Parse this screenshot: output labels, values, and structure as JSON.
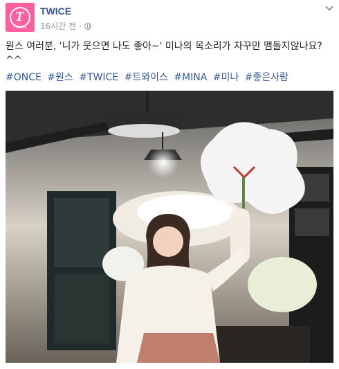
{
  "page": {
    "name": "TWICE",
    "avatar_label": "TWICE",
    "timestamp": "16시간 전"
  },
  "post": {
    "text": "원스 여러분, '니가 웃으면 나도 좋아~' 미나의 목소리가 자꾸만 맴돌지않나요?^^",
    "hashtags": [
      "#ONCE",
      "#원스",
      "#TWICE",
      "#트와이스",
      "#MINA",
      "#미나",
      "#좋은사람"
    ]
  },
  "colors": {
    "brand_pink": "#ff5f9e",
    "link_blue": "#365899",
    "meta_gray": "#90949c"
  }
}
